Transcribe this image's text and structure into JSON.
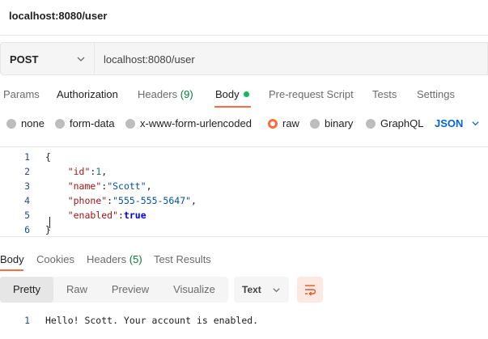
{
  "window": {
    "title": "localhost:8080/user"
  },
  "request": {
    "method": "POST",
    "url": "localhost:8080/user",
    "tabs": [
      {
        "label": "Params"
      },
      {
        "label": "Authorization"
      },
      {
        "label": "Headers",
        "count": "(9)"
      },
      {
        "label": "Body",
        "active": true
      },
      {
        "label": "Pre-request Script"
      },
      {
        "label": "Tests"
      },
      {
        "label": "Settings"
      }
    ],
    "body_types": [
      {
        "label": "none"
      },
      {
        "label": "form-data"
      },
      {
        "label": "x-www-form-urlencoded"
      },
      {
        "label": "raw",
        "selected": true
      },
      {
        "label": "binary"
      },
      {
        "label": "GraphQL"
      }
    ],
    "format": "JSON",
    "editor": {
      "line_numbers": [
        "1",
        "2",
        "3",
        "4",
        "5",
        "6"
      ],
      "lines": [
        {
          "text": "{"
        },
        {
          "key": "\"id\"",
          "value": "1",
          "trail": ","
        },
        {
          "key": "\"name\"",
          "value": "\"Scott\"",
          "trail": ","
        },
        {
          "key": "\"phone\"",
          "value": "\"555-555-5647\"",
          "trail": ","
        },
        {
          "key": "\"enabled\"",
          "value": "true",
          "trail": ""
        },
        {
          "text": "}"
        }
      ]
    }
  },
  "response": {
    "tabs": [
      {
        "label": "Body",
        "active": true
      },
      {
        "label": "Cookies"
      },
      {
        "label": "Headers",
        "count": "(5)"
      },
      {
        "label": "Test Results"
      }
    ],
    "views": [
      {
        "label": "Pretty",
        "active": true
      },
      {
        "label": "Raw"
      },
      {
        "label": "Preview"
      },
      {
        "label": "Visualize"
      }
    ],
    "type_select": "Text",
    "body": {
      "line_number": "1",
      "text": "Hello! Scott. Your account is enabled."
    }
  },
  "colors": {
    "accent": "#ff6c37",
    "count_green": "#007f31",
    "dot_green": "#0cbb52",
    "link_blue": "#0265d2"
  }
}
